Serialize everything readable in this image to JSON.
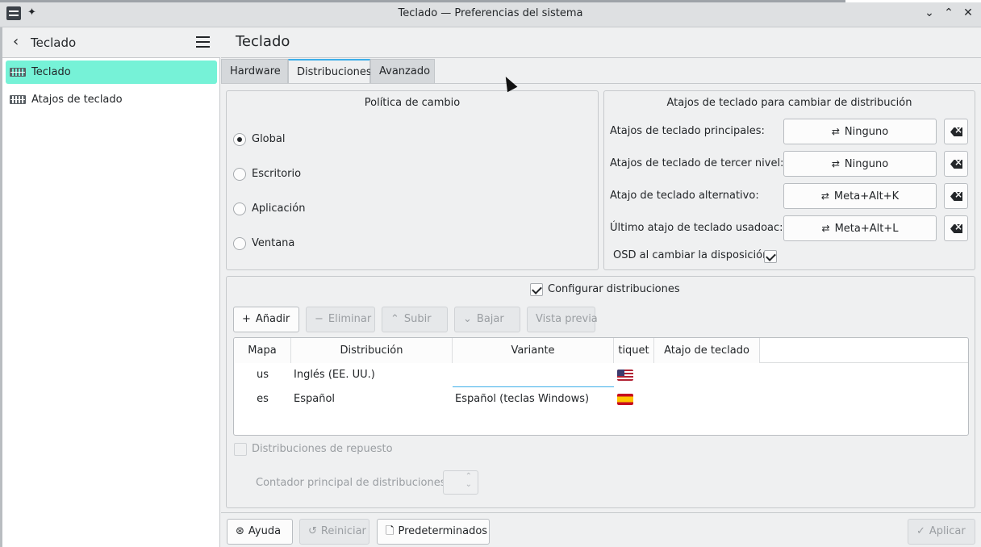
{
  "window": {
    "title": "Teclado — Preferencias del sistema"
  },
  "sidebar": {
    "title": "Teclado",
    "items": [
      {
        "label": "Teclado",
        "active": true
      },
      {
        "label": "Atajos de teclado",
        "active": false
      }
    ]
  },
  "main": {
    "title": "Teclado",
    "tabs": [
      {
        "label": "Hardware"
      },
      {
        "label": "Distribuciones",
        "active": true
      },
      {
        "label": "Avanzado"
      }
    ]
  },
  "policy": {
    "title": "Política de cambio",
    "options": [
      {
        "label": "Global",
        "checked": true
      },
      {
        "label": "Escritorio"
      },
      {
        "label": "Aplicación"
      },
      {
        "label": "Ventana"
      }
    ]
  },
  "shortcuts": {
    "title": "Atajos de teclado para cambiar de distribución",
    "rows": [
      {
        "label": "Atajos de teclado principales:",
        "value": "Ninguno"
      },
      {
        "label": "Atajos de teclado de tercer nivel:",
        "value": "Ninguno"
      },
      {
        "label": "Atajo de teclado alternativo:",
        "value": "Meta+Alt+K"
      },
      {
        "label": "Último atajo de teclado usadoac:",
        "value": "Meta+Alt+L"
      }
    ],
    "osd_label": "OSD al cambiar la disposición",
    "osd_checked": true
  },
  "layouts": {
    "configure_label": "Configurar distribuciones",
    "configure_checked": true,
    "toolbar": {
      "add": "Añadir",
      "remove": "Eliminar",
      "up": "Subir",
      "down": "Bajar",
      "preview": "Vista previa"
    },
    "columns": [
      "Mapa",
      "Distribución",
      "Variante",
      "tiquet",
      "Atajo de teclado"
    ],
    "rows": [
      {
        "map": "us",
        "layout": "Inglés (EE. UU.)",
        "variant": "",
        "flag": "us-flag",
        "shortcut": ""
      },
      {
        "map": "es",
        "layout": "Español",
        "variant": "Español (teclas Windows)",
        "flag": "es-flag",
        "shortcut": ""
      }
    ],
    "spare_label": "Distribuciones de repuesto",
    "spare_counter_label": "Contador principal de distribuciones:"
  },
  "footer": {
    "help": "Ayuda",
    "reset": "Reiniciar",
    "defaults": "Predeterminados",
    "apply": "Aplicar"
  },
  "colors": {
    "accent": "#3daee9",
    "sidebar_active": "#76f2d7"
  }
}
